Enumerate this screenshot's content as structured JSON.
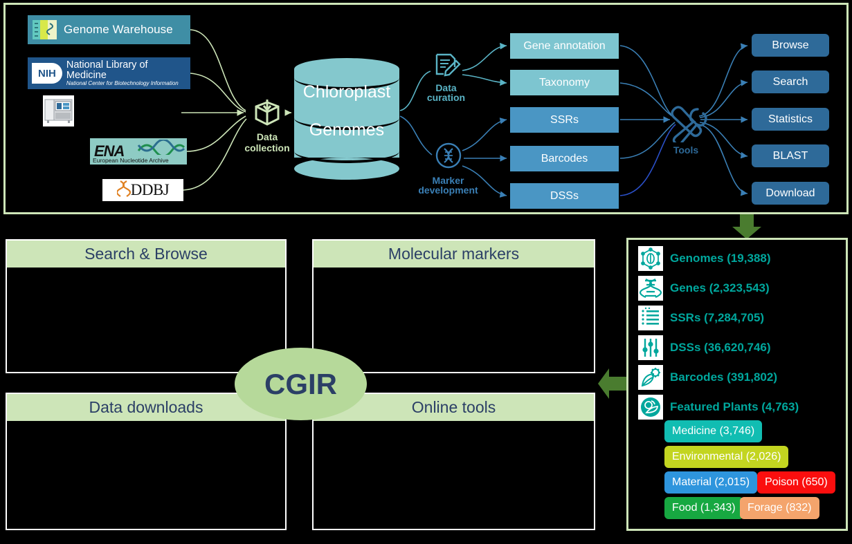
{
  "workflow": {
    "sources": [
      {
        "name": "Genome Warehouse",
        "icon": "genome-warehouse-icon"
      },
      {
        "name": "National Library of Medicine",
        "subtitle": "National Center for Biotechnology Information",
        "badge": "NIH"
      },
      {
        "name": "sequencer",
        "icon": "sequencer-icon"
      },
      {
        "name": "ENA",
        "subtitle": "European Nucleotide Archive"
      },
      {
        "name": "DDBJ"
      }
    ],
    "collection": {
      "line1": "Data",
      "line2": "collection",
      "icon": "cube-download-icon"
    },
    "database": {
      "line1": "Chloroplast",
      "line2": "Genomes",
      "icon": "database-cylinder-icon"
    },
    "processes": [
      {
        "line1": "Data",
        "line2": "curation",
        "icon": "document-pencil-icon",
        "color": "#5ab4c6"
      },
      {
        "line1": "Marker",
        "line2": "development",
        "icon": "dna-circle-icon",
        "color": "#3a7fb5"
      }
    ],
    "categories": [
      {
        "label": "Gene annotation",
        "tone": "light"
      },
      {
        "label": "Taxonomy",
        "tone": "light"
      },
      {
        "label": "SSRs",
        "tone": "dark"
      },
      {
        "label": "Barcodes",
        "tone": "dark"
      },
      {
        "label": "DSSs",
        "tone": "dark"
      }
    ],
    "tools": {
      "label": "Tools",
      "icon": "hammer-wrench-icon"
    },
    "actions": [
      {
        "label": "Browse"
      },
      {
        "label": "Search"
      },
      {
        "label": "Statistics"
      },
      {
        "label": "BLAST"
      },
      {
        "label": "Download"
      }
    ]
  },
  "portal": {
    "brand": "CGIR",
    "panels": [
      {
        "title": "Search & Browse"
      },
      {
        "title": "Molecular markers"
      },
      {
        "title": "Data downloads"
      },
      {
        "title": "Online tools"
      }
    ]
  },
  "statistics": {
    "rows": [
      {
        "label": "Genomes (19,388)",
        "icon": "genome-network-icon"
      },
      {
        "label": "Genes (2,323,543)",
        "icon": "dna-helix-icon"
      },
      {
        "label": "SSRs (7,284,705)",
        "icon": "repeat-list-icon"
      },
      {
        "label": "DSSs (36,620,746)",
        "icon": "sliders-icon"
      },
      {
        "label": "Barcodes (391,802)",
        "icon": "leaf-gear-icon"
      },
      {
        "label": "Featured Plants (4,763)",
        "icon": "plant-circle-icon"
      }
    ],
    "tags": [
      {
        "label": "Medicine (3,746)",
        "color": "#11bdb2"
      },
      {
        "label": "Environmental (2,026)",
        "color": "#c3d520"
      },
      {
        "label": "Material (2,015)",
        "color": "#2e95dd"
      },
      {
        "label": "Poison (650)",
        "color": "#fb0e0e"
      },
      {
        "label": "Food (1,343)",
        "color": "#17a841"
      },
      {
        "label": "Forage (832)",
        "color": "#f4a46c"
      }
    ]
  },
  "colors": {
    "frame": "#cde5b8",
    "accent_teal": "#00a79d",
    "accent_blue": "#2e6a99",
    "arrow_green": "#4a7c2f"
  }
}
